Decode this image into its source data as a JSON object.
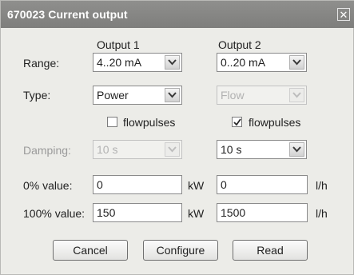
{
  "window": {
    "title": "670023 Current output",
    "close_label": "✕"
  },
  "columns": {
    "output1": "Output 1",
    "output2": "Output 2"
  },
  "labels": {
    "range": "Range:",
    "type": "Type:",
    "damping": "Damping:",
    "zero_value": "0% value:",
    "full_value": "100% value:"
  },
  "output1": {
    "range": "4..20 mA",
    "type": "Power",
    "flowpulses_label": "flowpulses",
    "flowpulses_checked": false,
    "damping": "10 s",
    "damping_enabled": false,
    "zero_value": "0",
    "full_value": "150",
    "unit": "kW"
  },
  "output2": {
    "range": "0..20 mA",
    "type": "Flow",
    "type_enabled": false,
    "flowpulses_label": "flowpulses",
    "flowpulses_checked": true,
    "damping": "10 s",
    "damping_enabled": true,
    "zero_value": "0",
    "full_value": "1500",
    "unit": "l/h"
  },
  "buttons": {
    "cancel": "Cancel",
    "configure": "Configure",
    "read": "Read"
  }
}
